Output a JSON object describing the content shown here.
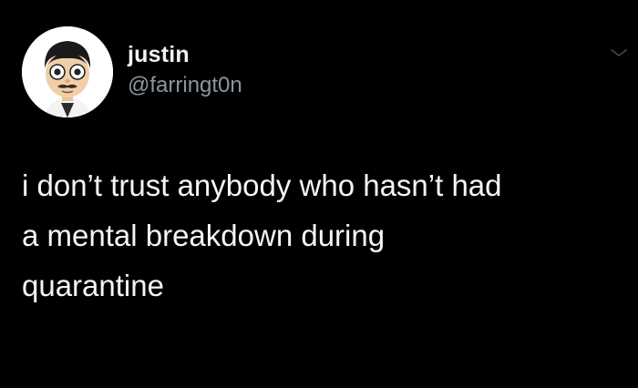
{
  "author": {
    "name": "justin",
    "handle": "@farringt0n",
    "avatar_icon": "mii-avatar-icon"
  },
  "menu": {
    "icon": "chevron-down-icon"
  },
  "tweet": {
    "lines": [
      "i don’t trust anybody who hasn’t had",
      "a mental breakdown during",
      "quarantine"
    ]
  },
  "colors": {
    "background": "#000000",
    "name": "#f2f2f2",
    "handle": "#8b959d",
    "text": "#f5f5f5",
    "chevron": "#3a3f44"
  }
}
